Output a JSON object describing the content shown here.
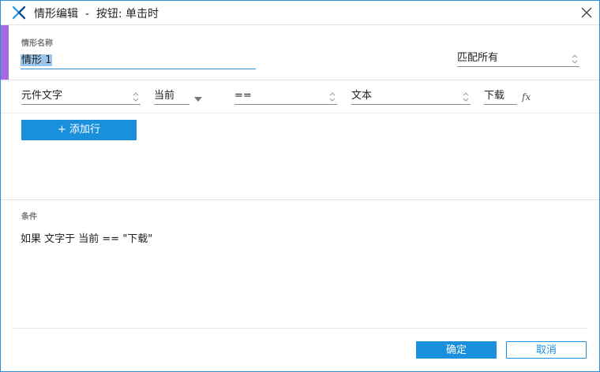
{
  "window": {
    "title": "情形编辑  -  按钮: 单击时",
    "accent_color": "#a569e0",
    "primary_color": "#1a90dd"
  },
  "scenario": {
    "label": "情形名称",
    "name_value": "情形 1",
    "match_select": "匹配所有"
  },
  "condition_row": {
    "target": "元件文字",
    "element": "当前",
    "operator": "==",
    "value_type": "文本",
    "value": "下载",
    "fx_icon": "fx"
  },
  "add_row_label": "+ 添加行",
  "summary": {
    "label": "条件",
    "text": "如果 文字于 当前 == \"下载\""
  },
  "footer": {
    "ok_label": "确定",
    "cancel_label": "取消"
  },
  "icons": {
    "logo": "axure-logo-icon",
    "close": "close-icon",
    "updown": "up-down-chevron-icon",
    "dropdown": "triangle-down-icon"
  }
}
